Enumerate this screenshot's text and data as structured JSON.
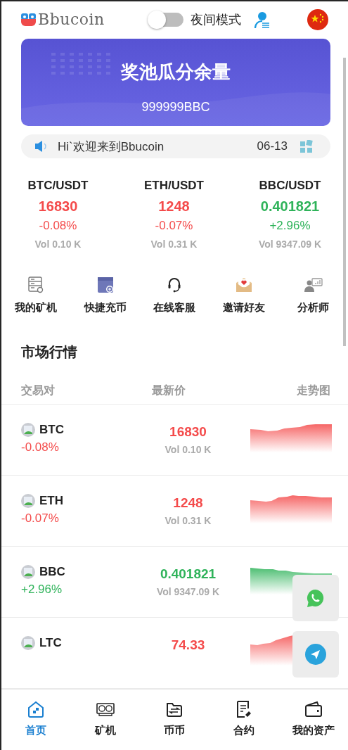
{
  "header": {
    "logo": "Bbucoin",
    "night_mode": {
      "label": "夜间模式",
      "on": false
    }
  },
  "banner": {
    "title": "奖池瓜分余量",
    "amount": "999999BBC"
  },
  "notice": {
    "text": "Hi`欢迎来到Bbucoin",
    "date": "06-13"
  },
  "tickers": [
    {
      "pair": "BTC/USDT",
      "price": "16830",
      "change": "-0.08%",
      "volume": "Vol 0.10 K",
      "rising": false
    },
    {
      "pair": "ETH/USDT",
      "price": "1248",
      "change": "-0.07%",
      "volume": "Vol 0.31 K",
      "rising": false
    },
    {
      "pair": "BBC/USDT",
      "price": "0.401821",
      "change": "+2.96%",
      "volume": "Vol 9347.09 K",
      "rising": true
    }
  ],
  "shortcuts": [
    {
      "label": "我的矿机",
      "kind": "miner"
    },
    {
      "label": "快捷充币",
      "kind": "deposit"
    },
    {
      "label": "在线客服",
      "kind": "support"
    },
    {
      "label": "邀请好友",
      "kind": "invite"
    },
    {
      "label": "分析师",
      "kind": "analyst"
    }
  ],
  "market": {
    "title": "市场行情",
    "columns": [
      "交易对",
      "最新价",
      "走势图"
    ],
    "rows": [
      {
        "symbol": "BTC",
        "change": "-0.08%",
        "price": "16830",
        "volume": "Vol 0.10 K",
        "rising": false
      },
      {
        "symbol": "ETH",
        "change": "-0.07%",
        "price": "1248",
        "volume": "Vol 0.31 K",
        "rising": false
      },
      {
        "symbol": "BBC",
        "change": "+2.96%",
        "price": "0.401821",
        "volume": "Vol 9347.09 K",
        "rising": true
      },
      {
        "symbol": "LTC",
        "price": "74.33",
        "rising": false
      }
    ]
  },
  "nav": [
    {
      "label": "首页",
      "kind": "home",
      "selected": true
    },
    {
      "label": "矿机",
      "kind": "miner",
      "selected": false
    },
    {
      "label": "币币",
      "kind": "exchange",
      "selected": false
    },
    {
      "label": "合约",
      "kind": "contract",
      "selected": false
    },
    {
      "label": "我的资产",
      "kind": "wallet",
      "selected": false
    }
  ]
}
